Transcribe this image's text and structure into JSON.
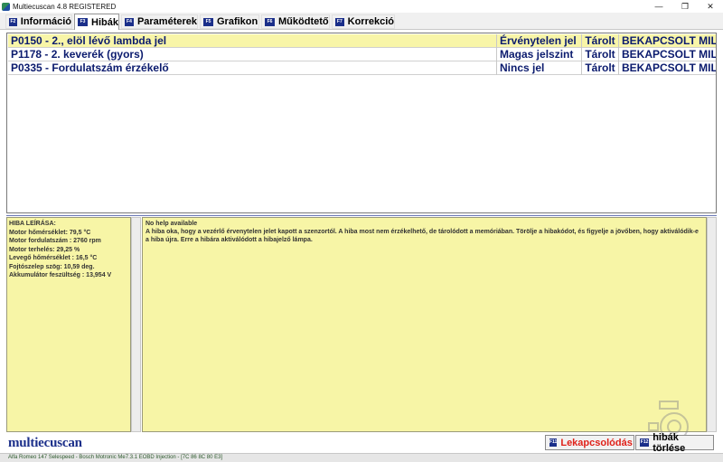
{
  "window": {
    "title": "Multiecuscan 4.8 REGISTERED",
    "min_glyph": "—",
    "max_glyph": "❐",
    "close_glyph": "✕"
  },
  "tabs": [
    {
      "key": "F2",
      "label": "Információ",
      "active": false
    },
    {
      "key": "F3",
      "label": "Hibák",
      "active": true
    },
    {
      "key": "F4",
      "label": "Paraméterek",
      "active": false
    },
    {
      "key": "F5",
      "label": "Grafikon",
      "active": false
    },
    {
      "key": "F6",
      "label": "Működtető",
      "active": false
    },
    {
      "key": "F7",
      "label": "Korrekció",
      "active": false
    }
  ],
  "faults": [
    {
      "name": "P0150 - 2., elöl lévő lambda jel",
      "status": "Érvénytelen jel",
      "type": "Tárolt",
      "mil": "BEKAPCSOLT MIL"
    },
    {
      "name": "P1178 - 2. keverék (gyors)",
      "status": "Magas jelszint",
      "type": "Tárolt",
      "mil": "BEKAPCSOLT MIL"
    },
    {
      "name": "P0335 - Fordulatszám érzékelő",
      "status": "Nincs jel",
      "type": "Tárolt",
      "mil": "BEKAPCSOLT MIL"
    }
  ],
  "params": {
    "header": "HIBA LEÍRÁSA:",
    "lines": [
      "Motor hőmérséklet: 79,5 °C",
      "Motor fordulatszám : 2760 rpm",
      "Motor terhelés: 29,25 %",
      "Levegő hőmérséklet : 16,5 °C",
      "Fojtószelep szög: 10,59 deg.",
      "Akkumulátor feszültség : 13,954 V"
    ]
  },
  "description": {
    "line1": "No help available",
    "line2": "A hiba oka, hogy a vezérlő érvenytelen jelet kapott a szenzortól. A hiba most nem érzékelhető, de tárolódott a memóriában. Törölje a hibakódot, és figyelje a jövőben, hogy aktiválódik-e a hiba újra. Erre a hibára aktiválódott a hibajelző lámpa."
  },
  "logo": "multiecuscan",
  "buttons": {
    "reconnect": {
      "key": "F11",
      "label": "Lekapcsolódás",
      "color": "#e0221a"
    },
    "clear": {
      "key": "F12",
      "label": "hibák törlése"
    }
  },
  "statusbar": "Alfa Romeo 147 Selespeed - Bosch Motronic Me7.3.1 EOBD Injection - [7C 86 8C 80 E3]",
  "colors": {
    "selection": "#f8f5a8",
    "fault_text": "#0b1b6e",
    "fkey_badge": "#1b2f8a",
    "panel_bg": "#f7f5a6"
  }
}
